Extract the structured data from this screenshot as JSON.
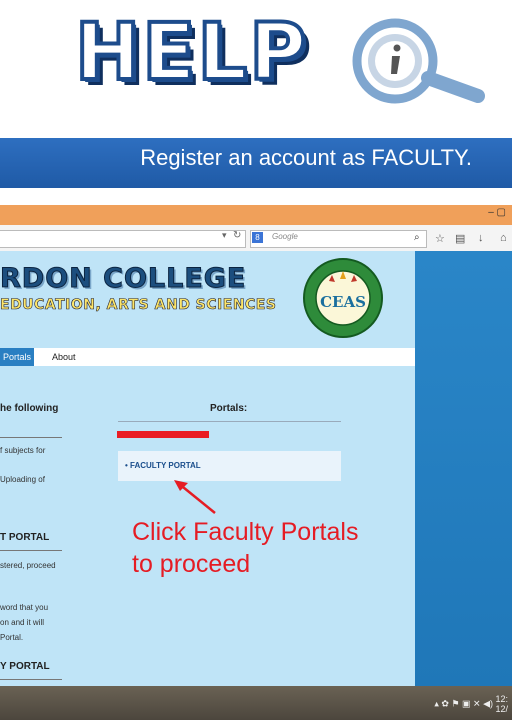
{
  "header": {
    "title": "HELP",
    "icon": "info-magnifier-icon"
  },
  "banner": {
    "text": "Register an account as FACULTY."
  },
  "browser": {
    "search_placeholder": "Google",
    "window_controls": "– ▢"
  },
  "site": {
    "college_name": "RDON COLLEGE",
    "college_subtitle": "EDUCATION, ARTS AND SCIENCES",
    "seal_text": "CEAS",
    "seal_ring_text": "College of Education, Arts and Sciences · Gordon College",
    "nav": {
      "portals": "Portals",
      "about": "About"
    },
    "left": {
      "heading1": "he following",
      "line1": "f subjects for",
      "line2": "Uploading of",
      "heading2": "T PORTAL",
      "line3": "stered, proceed",
      "line4": "word that you",
      "line5": "on and it will",
      "line6": "Portal.",
      "heading3": "Y PORTAL"
    },
    "portals_title": "Portals:",
    "faculty_link": "• FACULTY PORTAL"
  },
  "instruction": {
    "line1": "Click Faculty Portals",
    "line2": "to proceed"
  },
  "tray": {
    "time": "12:",
    "date": "12/"
  },
  "colors": {
    "banner": "#2e6fc0",
    "accent_red": "#e51c24",
    "titlebar": "#f0a05a",
    "desktop": "#2a86c8"
  }
}
